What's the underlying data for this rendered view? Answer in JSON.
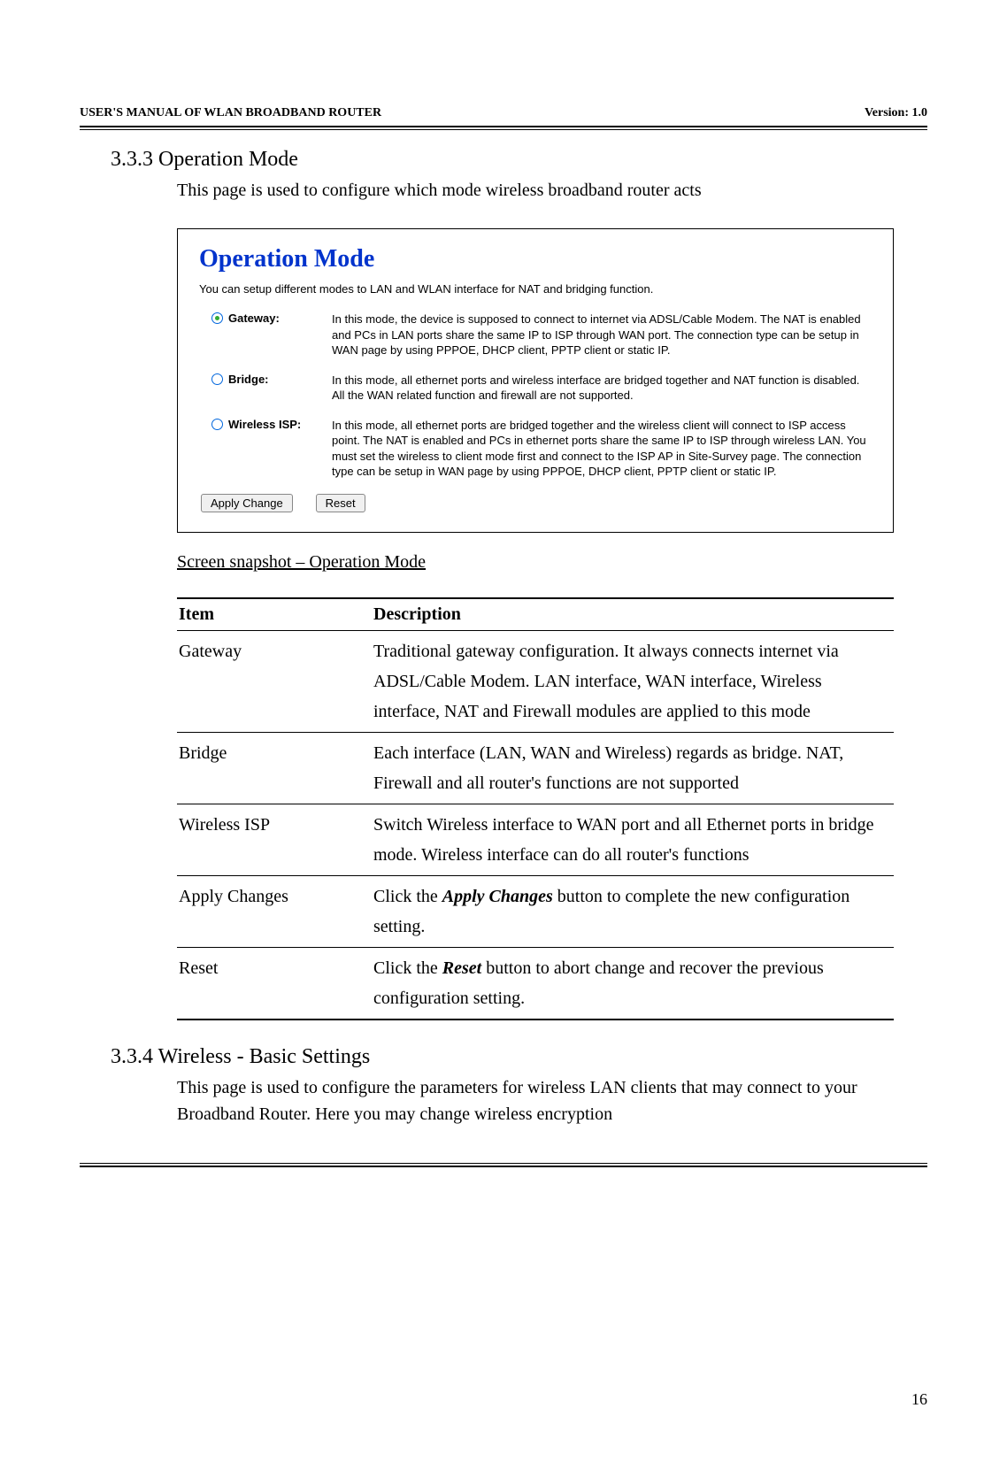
{
  "header": {
    "left": "USER'S MANUAL OF WLAN BROADBAND ROUTER",
    "right": "Version: 1.0"
  },
  "section1": {
    "num_title": "3.3.3  Operation Mode",
    "intro": "This page is used to configure which mode wireless broadband router acts"
  },
  "screenshot": {
    "title": "Operation Mode",
    "subtitle": "You can setup different modes to LAN and WLAN interface for NAT and bridging function.",
    "modes": [
      {
        "label": "Gateway:",
        "checked": true,
        "desc": "In this mode, the device is supposed to connect to internet via ADSL/Cable Modem. The NAT is enabled and PCs in LAN ports share the same IP to ISP through WAN port. The connection type can be setup in WAN page by using PPPOE, DHCP client, PPTP client or static IP."
      },
      {
        "label": "Bridge:",
        "checked": false,
        "desc": "In this mode, all ethernet ports and wireless interface are bridged together and NAT function is disabled. All the WAN related function and firewall are not supported."
      },
      {
        "label": "Wireless ISP:",
        "checked": false,
        "desc": "In this mode, all ethernet ports are bridged together and the wireless client will connect to ISP access point. The NAT is enabled and PCs in ethernet ports share the same IP to ISP through wireless LAN. You must set the wireless to client mode first and connect to the ISP AP in Site-Survey page. The connection type can be setup in WAN page by using PPPOE, DHCP client, PPTP client or static IP."
      }
    ],
    "buttons": {
      "apply": "Apply Change",
      "reset": "Reset"
    }
  },
  "caption": "Screen snapshot – Operation Mode",
  "table": {
    "headers": {
      "item": "Item",
      "desc": "Description"
    },
    "rows": [
      {
        "item": "Gateway",
        "desc": "Traditional gateway configuration. It always connects internet via ADSL/Cable Modem. LAN interface, WAN interface, Wireless interface, NAT and Firewall modules are applied to this mode"
      },
      {
        "item": "Bridge",
        "desc": "Each interface (LAN, WAN and Wireless) regards as bridge. NAT, Firewall and all router's functions are not supported"
      },
      {
        "item": "Wireless ISP",
        "desc": "Switch Wireless interface to WAN port and all Ethernet ports in bridge mode. Wireless interface can do all router's functions"
      },
      {
        "item": "Apply Changes",
        "desc_pre": "Click the ",
        "desc_em": "Apply Changes",
        "desc_post": " button to complete the new configuration setting."
      },
      {
        "item": "Reset",
        "desc_pre": "Click the ",
        "desc_em": "Reset",
        "desc_post": " button to abort change and recover the previous configuration setting."
      }
    ]
  },
  "section2": {
    "num_title": "3.3.4  Wireless - Basic Settings",
    "intro": "This page is used to configure the parameters for wireless LAN clients that may connect to your Broadband Router. Here you may change wireless encryption"
  },
  "page_number": "16"
}
